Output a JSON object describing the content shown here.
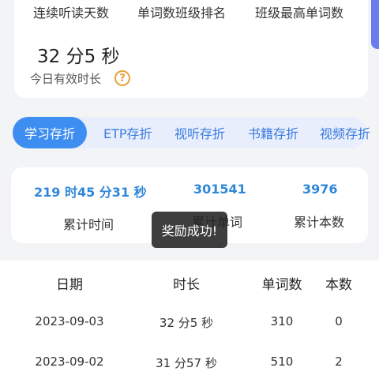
{
  "stats": {
    "labels": [
      "连续听读天数",
      "单词数班级排名",
      "班级最高单词数"
    ]
  },
  "today": {
    "value": "32 分5 秒",
    "label": "今日有效时长",
    "help_icon": "?"
  },
  "tabs": [
    "学习存折",
    "ETP存折",
    "视听存折",
    "书籍存折",
    "视频存折"
  ],
  "totals": {
    "values": [
      "219 时45 分31 秒",
      "301541",
      "3976"
    ],
    "labels": [
      "累计时间",
      "累计单词",
      "累计本数"
    ]
  },
  "toast": "奖励成功!",
  "table": {
    "headers": [
      "日期",
      "时长",
      "单词数",
      "本数"
    ],
    "rows": [
      [
        "2023-09-03",
        "32 分5 秒",
        "310",
        "0"
      ],
      [
        "2023-09-02",
        "31 分57 秒",
        "510",
        "2"
      ]
    ]
  },
  "colors": {
    "accent": "#3d8ef0",
    "tab_text": "#3a7be0",
    "value_blue": "#2f87d8",
    "help_orange": "#e6a23c",
    "edge_purple": "#6a7cf0"
  }
}
